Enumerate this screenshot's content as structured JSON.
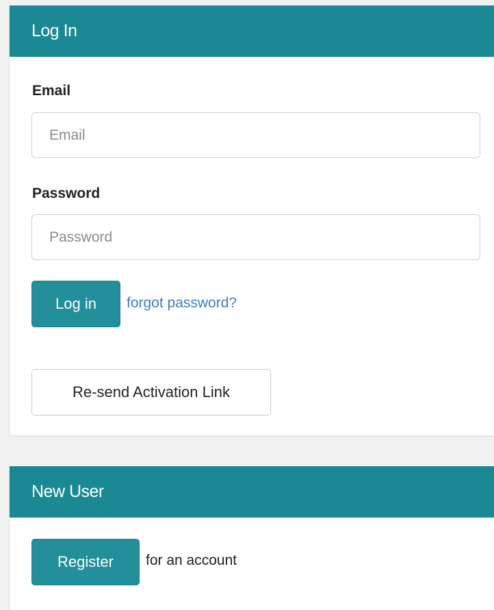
{
  "login": {
    "heading": "Log In",
    "email_label": "Email",
    "email_placeholder": "Email",
    "email_value": "",
    "password_label": "Password",
    "password_placeholder": "Password",
    "password_value": "",
    "login_button": "Log in",
    "forgot_link": "forgot password?",
    "resend_button": "Re-send Activation Link"
  },
  "new_user": {
    "heading": "New User",
    "register_button": "Register",
    "register_suffix": "for an account"
  },
  "colors": {
    "header_bg": "#1a8993",
    "primary_button": "#228f9a",
    "link": "#3a7fc1",
    "page_bg": "#f1f1f1"
  }
}
